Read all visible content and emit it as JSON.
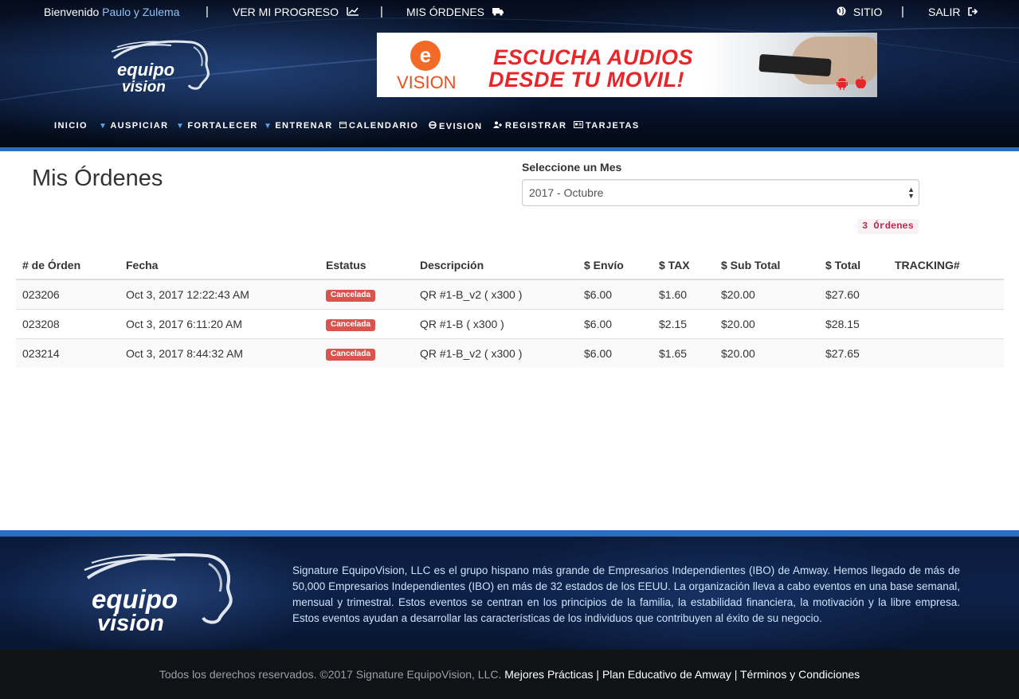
{
  "topbar": {
    "welcome_label": "Bienvenido",
    "welcome_name": "Paulo y Zulema",
    "progress_label": "VER MI PROGRESO",
    "orders_label": "MIS ÓRDENES",
    "site_label": "SITIO",
    "logout_label": "SALIR",
    "separator": "|"
  },
  "logo": {
    "line1": "equipo",
    "line2": "vision"
  },
  "banner": {
    "ev_letter": "e",
    "ev_word": "VISION",
    "promo_line1": "ESCUCHA AUDIOS",
    "promo_line2": "DESDE TU MOVIL!"
  },
  "nav": {
    "items": [
      {
        "label": "INICIO",
        "icon": "none"
      },
      {
        "label": "AUSPICIAR",
        "icon": "caret-down"
      },
      {
        "label": "FORTALECER",
        "icon": "caret-down"
      },
      {
        "label": "ENTRENAR",
        "icon": "caret-down"
      },
      {
        "label": "CALENDARIO",
        "icon": "calendar-icon"
      },
      {
        "label": "EVISION",
        "icon": "e-icon"
      },
      {
        "label": "REGISTRAR",
        "icon": "user-plus-icon"
      },
      {
        "label": "TARJETAS",
        "icon": "card-icon"
      }
    ]
  },
  "main": {
    "title": "Mis Órdenes",
    "month_label": "Seleccione un Mes",
    "month_selected": "2017 - Octubre",
    "orders_count": "3 Órdenes"
  },
  "table": {
    "headers": [
      "# de Órden",
      "Fecha",
      "Estatus",
      "Descripción",
      "$ Envío",
      "$ TAX",
      "$ Sub Total",
      "$ Total",
      "TRACKING#"
    ],
    "rows": [
      {
        "order": "023206",
        "date": "Oct 3, 2017 12:22:43 AM",
        "status": "Cancelada",
        "desc": "QR #1-B_v2 ( x300 )",
        "shipping": "$6.00",
        "tax": "$1.60",
        "subtotal": "$20.00",
        "total": "$27.60",
        "tracking": ""
      },
      {
        "order": "023208",
        "date": "Oct 3, 2017 6:11:20 AM",
        "status": "Cancelada",
        "desc": "QR #1-B ( x300 )",
        "shipping": "$6.00",
        "tax": "$2.15",
        "subtotal": "$20.00",
        "total": "$28.15",
        "tracking": ""
      },
      {
        "order": "023214",
        "date": "Oct 3, 2017 8:44:32 AM",
        "status": "Cancelada",
        "desc": "QR #1-B_v2 ( x300 )",
        "shipping": "$6.00",
        "tax": "$1.65",
        "subtotal": "$20.00",
        "total": "$27.65",
        "tracking": ""
      }
    ]
  },
  "footer": {
    "description": "Signature EquipoVision, LLC es el grupo hispano más grande de Empresarios Independientes (IBO) de Amway. Hemos llegado de más de 50,000 Empresarios Independientes (IBO) en más de 32 estados de los EEUU. La organización lleva a cabo eventos en una base semanal, mensual y trimestral. Estos eventos se centran en los principios de la familia, la estabilidad financiera, la motivación y la libre empresa. Estos eventos ayudan a desarrollar las características de los individuos que contribuyen al éxito de su negocio.",
    "copyright": "Todos los derechos reservados. ©2017 Signature EquipoVision, LLC.",
    "link1": "Mejores Prácticas",
    "link2": "Plan Educativo de Amway",
    "link3": "Términos y Condiciones",
    "separator": "|"
  },
  "colors": {
    "accent_blue": "#2a6fbe",
    "name_blue": "#8fc3f5",
    "danger": "#d9534f",
    "badge_text": "#c7254e",
    "banner_red": "#e8262a",
    "ev_orange": "#f26a25"
  }
}
